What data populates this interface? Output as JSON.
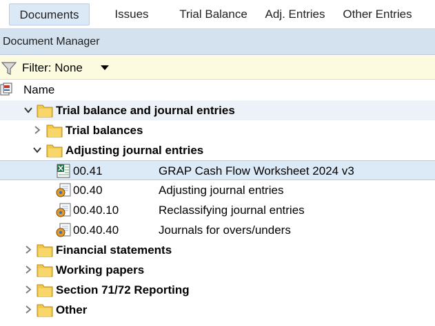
{
  "tabs": [
    {
      "label": "Documents",
      "active": true
    },
    {
      "label": "Issues",
      "active": false
    },
    {
      "label": "Trial Balance",
      "active": false
    },
    {
      "label": "Adj. Entries",
      "active": false
    },
    {
      "label": "Other Entries",
      "active": false
    }
  ],
  "panel": {
    "title": "Document Manager"
  },
  "filter": {
    "label": "Filter: None"
  },
  "columns": {
    "name": "Name"
  },
  "tree": {
    "root": {
      "label": "Trial balance and journal entries",
      "expanded": true
    },
    "trial_balances": {
      "label": "Trial balances",
      "expanded": false
    },
    "adjusting": {
      "label": "Adjusting journal entries",
      "expanded": true
    },
    "docs": [
      {
        "code": "00.41",
        "name": "GRAP Cash Flow Worksheet 2024 v3",
        "icon": "excel-icon",
        "selected": true
      },
      {
        "code": "00.40",
        "name": "Adjusting journal entries",
        "icon": "journal-icon",
        "selected": false
      },
      {
        "code": "00.40.10",
        "name": "Reclassifying journal entries",
        "icon": "journal-icon",
        "selected": false
      },
      {
        "code": "00.40.40",
        "name": "Journals for overs/unders",
        "icon": "journal-icon",
        "selected": false
      }
    ],
    "folders": [
      {
        "label": "Financial statements",
        "expanded": false
      },
      {
        "label": "Working papers",
        "expanded": false
      },
      {
        "label": "Section 71/72 Reporting",
        "expanded": false
      },
      {
        "label": "Other",
        "expanded": false
      }
    ]
  },
  "colors": {
    "accent": "#dbe8f6",
    "header": "#d4e1ef",
    "filter_bg": "#fdfbdf",
    "folder": "#f2c84b"
  }
}
